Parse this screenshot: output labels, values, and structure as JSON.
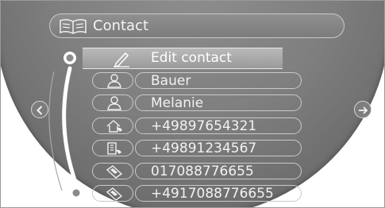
{
  "header": {
    "title": "Contact",
    "icon": "address-book-icon"
  },
  "selected": {
    "label": "Edit contact",
    "icon": "pencil-icon"
  },
  "rows": [
    {
      "text": "Bauer",
      "icon": "person-icon"
    },
    {
      "text": "Melanie",
      "icon": "person-icon"
    },
    {
      "text": "+49897654321",
      "icon": "home-phone-icon"
    },
    {
      "text": "+49891234567",
      "icon": "office-phone-icon"
    },
    {
      "text": "017088776655",
      "icon": "mobile-phone-icon"
    },
    {
      "text": "+4917088776655",
      "icon": "mobile-phone-icon"
    }
  ],
  "nav": {
    "left": "chevron-left-icon",
    "right": "arrow-right-icon"
  },
  "colors": {
    "panel": "#7f7f7f",
    "outline": "#c9c9c9",
    "text": "#f2f2f2",
    "highlight": "#ffffff"
  }
}
